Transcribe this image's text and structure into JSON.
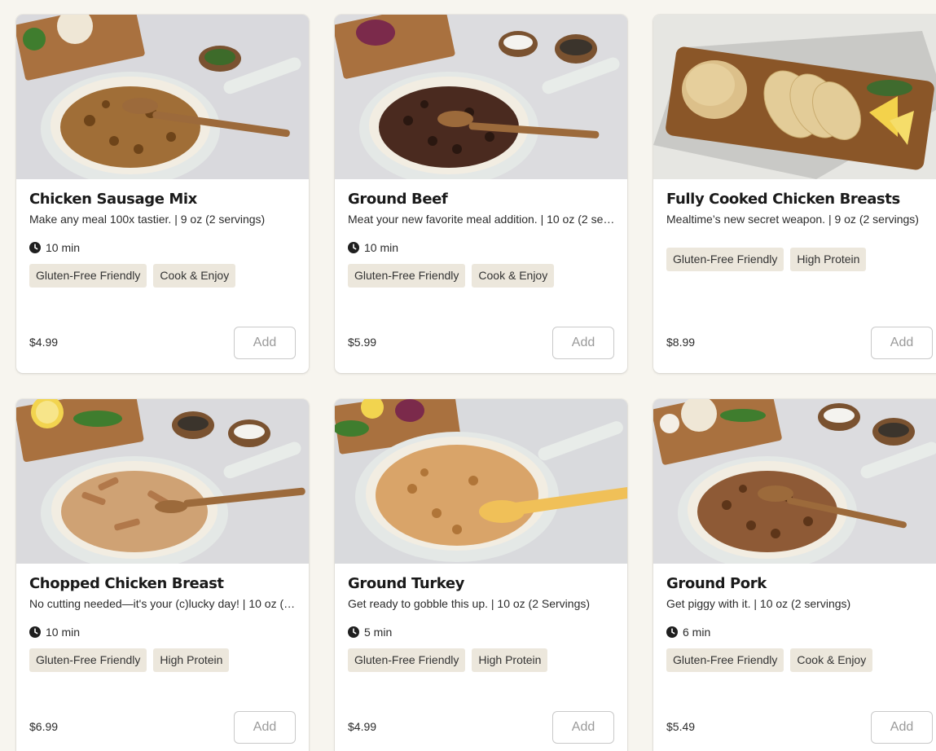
{
  "colors": {
    "page_background": "#f7f5ef",
    "tag_background": "#ece7dc",
    "button_border": "#c9c9c9",
    "button_text": "#9a9a9a"
  },
  "add_label": "Add",
  "products": [
    {
      "title": "Chicken Sausage Mix",
      "description": "Make any meal 100x tastier. | 9 oz (2 servings)",
      "time": "10 min",
      "tags": [
        "Gluten-Free Friendly",
        "Cook & Enjoy"
      ],
      "price": "$4.99",
      "image": "pan-chicken-sausage-photo"
    },
    {
      "title": "Ground Beef",
      "description": "Meat your new favorite meal addition. | 10 oz (2 se…",
      "time": "10 min",
      "tags": [
        "Gluten-Free Friendly",
        "Cook & Enjoy"
      ],
      "price": "$5.99",
      "image": "pan-ground-beef-photo"
    },
    {
      "title": "Fully Cooked Chicken Breasts",
      "description": "Mealtime’s new secret weapon. | 9 oz (2 servings)",
      "time": "",
      "tags": [
        "Gluten-Free Friendly",
        "High Protein"
      ],
      "price": "$8.99",
      "image": "cutting-board-chicken-photo"
    },
    {
      "title": "Chopped Chicken Breast",
      "description": "No cutting needed—it's your (c)lucky day! | 10 oz (…",
      "time": "10 min",
      "tags": [
        "Gluten-Free Friendly",
        "High Protein"
      ],
      "price": "$6.99",
      "image": "pan-chopped-chicken-photo"
    },
    {
      "title": "Ground Turkey",
      "description": "Get ready to gobble this up. | 10 oz (2 Servings)",
      "time": "5 min",
      "tags": [
        "Gluten-Free Friendly",
        "High Protein"
      ],
      "price": "$4.99",
      "image": "pan-ground-turkey-photo"
    },
    {
      "title": "Ground Pork",
      "description": "Get piggy with it. | 10 oz (2 servings)",
      "time": "6 min",
      "tags": [
        "Gluten-Free Friendly",
        "Cook & Enjoy"
      ],
      "price": "$5.49",
      "image": "pan-ground-pork-photo"
    }
  ]
}
